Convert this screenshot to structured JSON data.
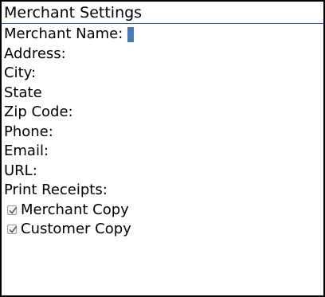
{
  "title": "Merchant Settings",
  "fields": {
    "merchant_name": "Merchant Name:",
    "address": "Address:",
    "city": "City:",
    "state": "State",
    "zip_code": "Zip Code:",
    "phone": "Phone:",
    "email": "Email:",
    "url": "URL:"
  },
  "print_receipts": {
    "label": "Print Receipts:",
    "merchant_copy": {
      "label": "Merchant Copy",
      "checked": true
    },
    "customer_copy": {
      "label": "Customer Copy",
      "checked": true
    }
  },
  "colors": {
    "accent": "#4a78bd",
    "divider": "#1c5ec4",
    "check": "#5a5a5a"
  }
}
